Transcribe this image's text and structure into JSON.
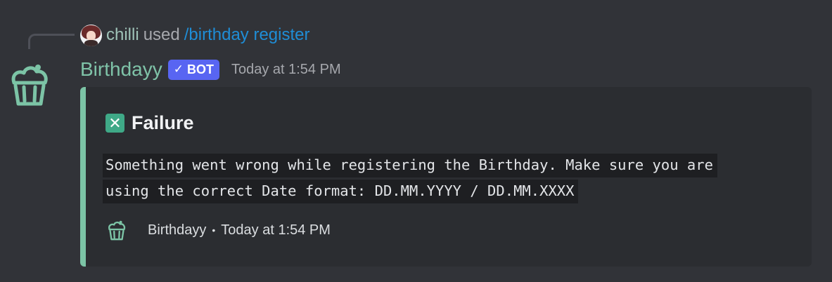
{
  "reply": {
    "username": "chilli",
    "used_text": "used",
    "command": "/birthday register"
  },
  "message": {
    "username": "Birthdayy",
    "bot_tag": "BOT",
    "bot_check": "✓",
    "timestamp": "Today at 1:54 PM"
  },
  "embed": {
    "accent_color": "#7cc4a6",
    "title_icon": "x-box-icon",
    "title_icon_glyph": "✕",
    "title": "Failure",
    "description_line1": "Something went wrong while registering the Birthday. Make sure you are",
    "description_line2": "using the correct Date format: DD.MM.YYYY / DD.MM.XXXX",
    "footer_name": "Birthdayy",
    "footer_separator": "•",
    "footer_timestamp": "Today at 1:54 PM"
  },
  "colors": {
    "background": "#313338",
    "embed_background": "#2b2d31",
    "username": "#7fc3a8",
    "command_link": "#1f8dd6",
    "bot_tag": "#5865f2"
  }
}
